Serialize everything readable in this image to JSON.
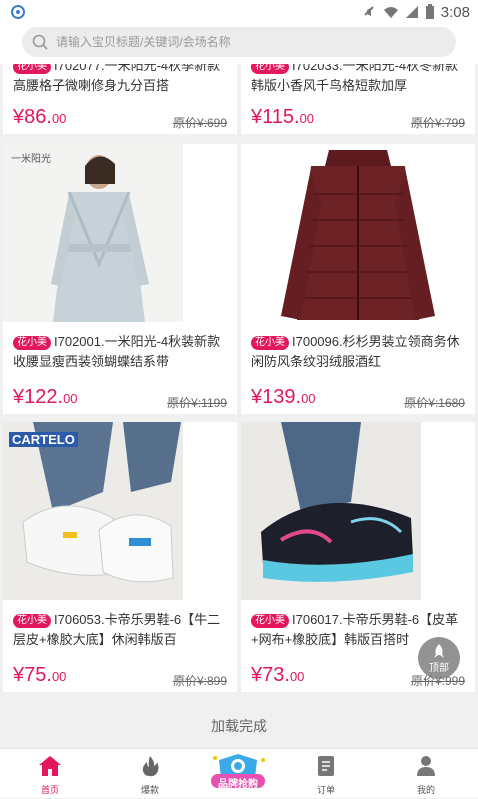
{
  "status_bar": {
    "time": "3:08"
  },
  "search": {
    "placeholder": "请输入宝贝标题/关键词/会场名称"
  },
  "colors": {
    "accent": "#e4175a",
    "price": "#e4175a"
  },
  "products": [
    {
      "tag": "花小美",
      "title": "I702077.一米阳光-4秋季新款高腰格子微喇修身九分百搭",
      "price_int": "¥86.",
      "price_dec": "00",
      "orig": "原价¥:699"
    },
    {
      "tag": "花小美",
      "title": "I702033.一米阳光-4秋冬新款韩版小香风千鸟格短款加厚",
      "price_int": "¥115.",
      "price_dec": "00",
      "orig": "原价¥:799"
    },
    {
      "tag": "花小美",
      "title": "I702001.一米阳光-4秋装新款收腰显瘦西装领蝴蝶结系带",
      "price_int": "¥122.",
      "price_dec": "00",
      "orig": "原价¥:1199",
      "img_text": "一米阳光"
    },
    {
      "tag": "花小美",
      "title": "I700096.杉杉男装立领商务休闲防风条纹羽绒服酒红",
      "price_int": "¥139.",
      "price_dec": "00",
      "orig": "原价¥:1680"
    },
    {
      "tag": "花小美",
      "title": "I706053.卡帝乐男鞋-6【牛二层皮+橡胶大底】休闲韩版百",
      "price_int": "¥75.",
      "price_dec": "00",
      "orig": "原价¥:899",
      "img_text": "CARTELO"
    },
    {
      "tag": "花小美",
      "title": "I706017.卡帝乐男鞋-6【皮革+网布+橡胶底】韩版百搭时",
      "price_int": "¥73.",
      "price_dec": "00",
      "orig": "原价¥:999"
    }
  ],
  "feed": {
    "load_done": "加载完成"
  },
  "to_top": {
    "label": "顶部"
  },
  "tabs": [
    {
      "label": "首页",
      "icon": "home-icon"
    },
    {
      "label": "爆款",
      "icon": "flame-icon"
    },
    {
      "label": "品牌抢购",
      "icon": "promo-badge"
    },
    {
      "label": "订单",
      "icon": "order-icon"
    },
    {
      "label": "我的",
      "icon": "user-icon"
    }
  ]
}
